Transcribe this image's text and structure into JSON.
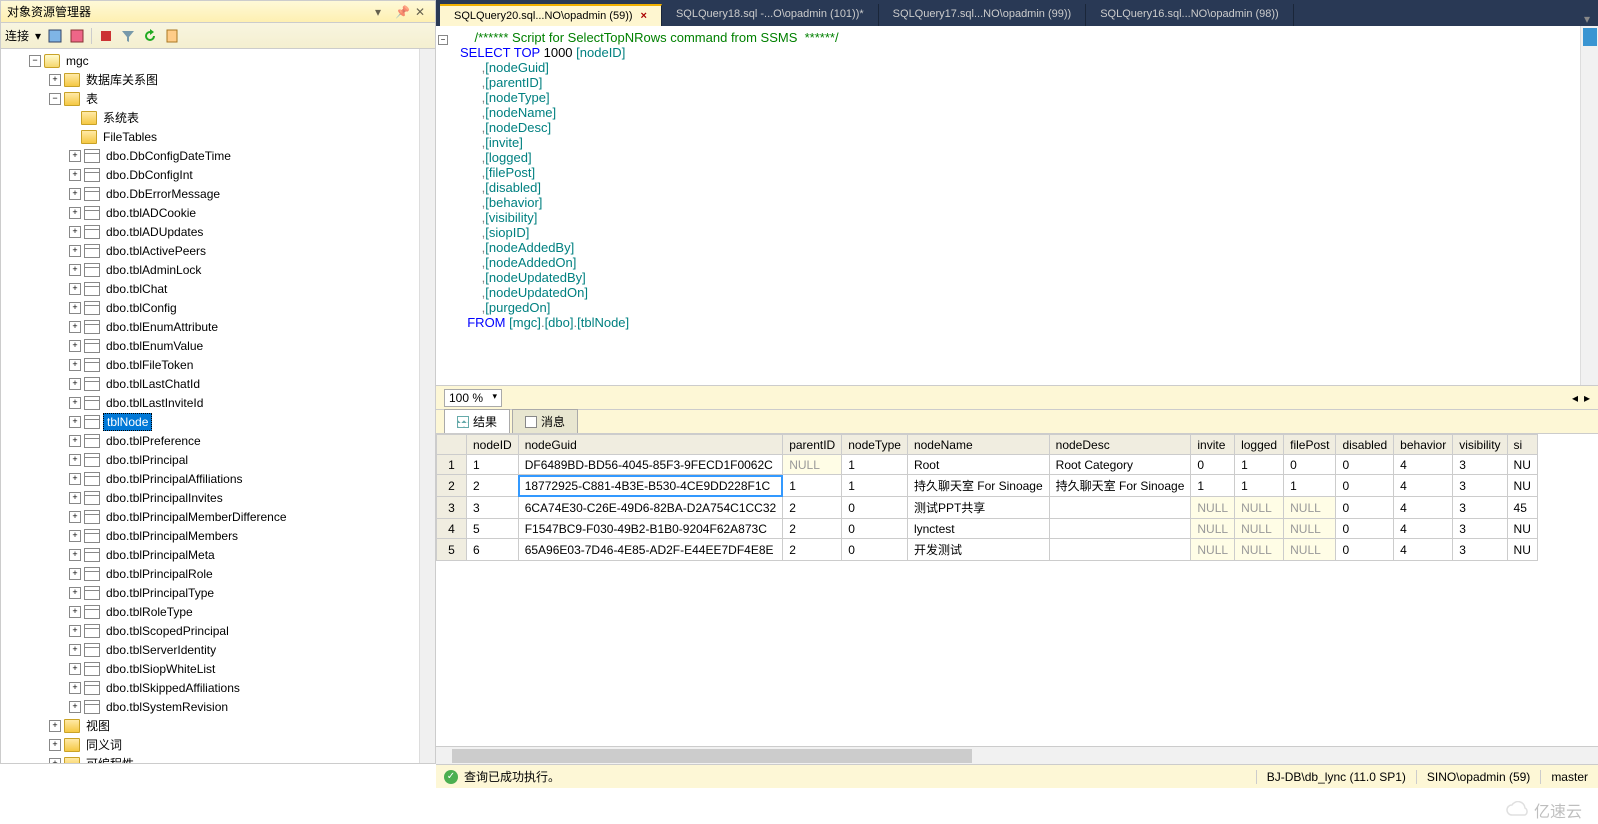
{
  "objectExplorer": {
    "title": "对象资源管理器",
    "connectLabel": "连接",
    "dbName": "mgc",
    "folders": {
      "diagrams": "数据库关系图",
      "tables": "表",
      "sysTables": "系统表",
      "fileTables": "FileTables",
      "views": "视图",
      "synonyms": "同义词",
      "programmability": "可编程性"
    },
    "tablesList": [
      "dbo.DbConfigDateTime",
      "dbo.DbConfigInt",
      "dbo.DbErrorMessage",
      "dbo.tblADCookie",
      "dbo.tblADUpdates",
      "dbo.tblActivePeers",
      "dbo.tblAdminLock",
      "dbo.tblChat",
      "dbo.tblConfig",
      "dbo.tblEnumAttribute",
      "dbo.tblEnumValue",
      "dbo.tblFileToken",
      "dbo.tblLastChatId",
      "dbo.tblLastInviteId",
      "dbo.tblPreference",
      "dbo.tblPrincipal",
      "dbo.tblPrincipalAffiliations",
      "dbo.tblPrincipalInvites",
      "dbo.tblPrincipalMemberDifference",
      "dbo.tblPrincipalMembers",
      "dbo.tblPrincipalMeta",
      "dbo.tblPrincipalRole",
      "dbo.tblPrincipalType",
      "dbo.tblRoleType",
      "dbo.tblScopedPrincipal",
      "dbo.tblServerIdentity",
      "dbo.tblSiopWhiteList",
      "dbo.tblSkippedAffiliations",
      "dbo.tblSystemRevision"
    ],
    "selectedTable": "tblNode"
  },
  "tabs": [
    {
      "label": "SQLQuery20.sql...NO\\opadmin (59))",
      "active": true
    },
    {
      "label": "SQLQuery18.sql -...O\\opadmin (101))*",
      "active": false
    },
    {
      "label": "SQLQuery17.sql...NO\\opadmin (99))",
      "active": false
    },
    {
      "label": "SQLQuery16.sql...NO\\opadmin (98))",
      "active": false
    }
  ],
  "sql": {
    "comment": "/****** Script for SelectTopNRows command from SSMS  ******/",
    "select": "SELECT",
    "top": "TOP",
    "topN": "1000",
    "cols": [
      "[nodeID]",
      "[nodeGuid]",
      "[parentID]",
      "[nodeType]",
      "[nodeName]",
      "[nodeDesc]",
      "[invite]",
      "[logged]",
      "[filePost]",
      "[disabled]",
      "[behavior]",
      "[visibility]",
      "[siopID]",
      "[nodeAddedBy]",
      "[nodeAddedOn]",
      "[nodeUpdatedBy]",
      "[nodeUpdatedOn]",
      "[purgedOn]"
    ],
    "from": "FROM",
    "fromTarget": "[mgc].[dbo].[tblNode]"
  },
  "zoom": "100 %",
  "resultTabs": {
    "results": "结果",
    "messages": "消息"
  },
  "grid": {
    "headers": [
      "nodeID",
      "nodeGuid",
      "parentID",
      "nodeType",
      "nodeName",
      "nodeDesc",
      "invite",
      "logged",
      "filePost",
      "disabled",
      "behavior",
      "visibility",
      "si"
    ],
    "rows": [
      {
        "n": "1",
        "cells": [
          "1",
          "DF6489BD-BD56-4045-85F3-9FECD1F0062C",
          "NULL",
          "1",
          "Root",
          "Root Category",
          "0",
          "1",
          "0",
          "0",
          "4",
          "3",
          "NU"
        ]
      },
      {
        "n": "2",
        "cells": [
          "2",
          "18772925-C881-4B3E-B530-4CE9DD228F1C",
          "1",
          "1",
          "持久聊天室 For Sinoage",
          "持久聊天室 For Sinoage",
          "1",
          "1",
          "1",
          "0",
          "4",
          "3",
          "NU"
        ]
      },
      {
        "n": "3",
        "cells": [
          "3",
          "6CA74E30-C26E-49D6-82BA-D2A754C1CC32",
          "2",
          "0",
          "测试PPT共享",
          "",
          "NULL",
          "NULL",
          "NULL",
          "0",
          "4",
          "3",
          "45"
        ]
      },
      {
        "n": "4",
        "cells": [
          "5",
          "F1547BC9-F030-49B2-B1B0-9204F62A873C",
          "2",
          "0",
          "lynctest",
          "",
          "NULL",
          "NULL",
          "NULL",
          "0",
          "4",
          "3",
          "NU"
        ]
      },
      {
        "n": "5",
        "cells": [
          "6",
          "65A96E03-7D46-4E85-AD2F-E44EE7DF4E8E",
          "2",
          "0",
          "开发测试",
          "",
          "NULL",
          "NULL",
          "NULL",
          "0",
          "4",
          "3",
          "NU"
        ]
      }
    ]
  },
  "status": {
    "ok": "查询已成功执行。",
    "server": "BJ-DB\\db_lync (11.0 SP1)",
    "user": "SINO\\opadmin (59)",
    "db": "master"
  },
  "watermark": "亿速云"
}
